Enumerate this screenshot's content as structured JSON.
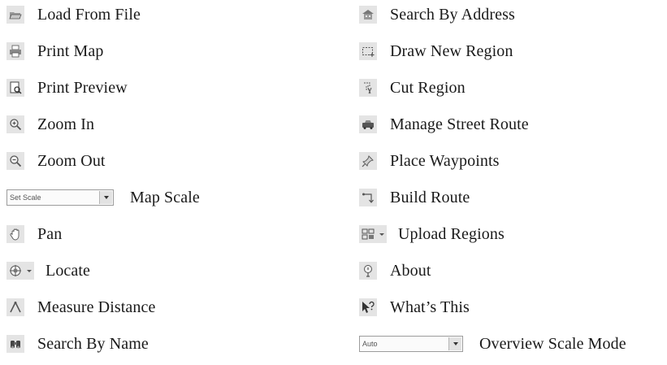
{
  "left": [
    {
      "label": "Load From File",
      "icon": "open-folder-icon"
    },
    {
      "label": "Print Map",
      "icon": "printer-icon"
    },
    {
      "label": "Print Preview",
      "icon": "print-preview-icon"
    },
    {
      "label": "Zoom In",
      "icon": "zoom-in-icon"
    },
    {
      "label": "Zoom Out",
      "icon": "zoom-out-icon"
    },
    {
      "label": "Map Scale",
      "dropdown_value": "Set Scale"
    },
    {
      "label": "Pan",
      "icon": "hand-icon"
    },
    {
      "label": "Locate",
      "icon": "locate-icon"
    },
    {
      "label": "Measure Distance",
      "icon": "measure-icon"
    },
    {
      "label": "Search By Name",
      "icon": "binoculars-icon"
    }
  ],
  "right": [
    {
      "label": "Search By Address",
      "icon": "building-icon"
    },
    {
      "label": "Draw New Region",
      "icon": "draw-region-icon"
    },
    {
      "label": "Cut Region",
      "icon": "cut-region-icon"
    },
    {
      "label": "Manage Street Route",
      "icon": "car-icon"
    },
    {
      "label": "Place Waypoints",
      "icon": "waypoint-pin-icon"
    },
    {
      "label": "Build Route",
      "icon": "route-icon"
    },
    {
      "label": "Upload Regions",
      "icon": "upload-regions-icon"
    },
    {
      "label": "About",
      "icon": "about-icon"
    },
    {
      "label": "What’s This",
      "icon": "whats-this-icon"
    },
    {
      "label": "Overview Scale Mode",
      "dropdown_value": "Auto"
    }
  ]
}
